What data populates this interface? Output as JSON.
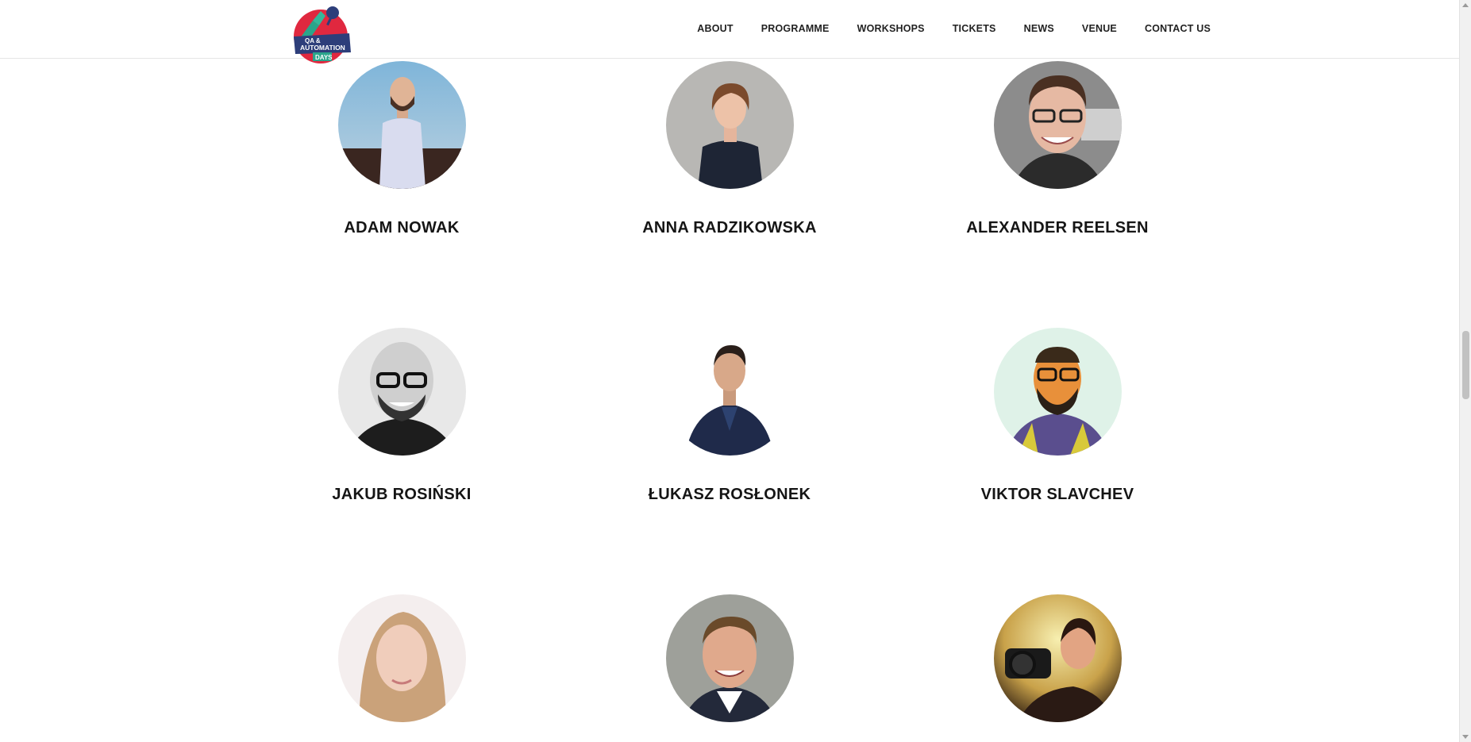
{
  "brand": {
    "logo_text_top": "QA &",
    "logo_text_mid": "AUTOMATION",
    "logo_text_bottom": "DAYS"
  },
  "nav": {
    "items": [
      {
        "label": "ABOUT"
      },
      {
        "label": "PROGRAMME"
      },
      {
        "label": "WORKSHOPS"
      },
      {
        "label": "TICKETS"
      },
      {
        "label": "NEWS"
      },
      {
        "label": "VENUE"
      },
      {
        "label": "CONTACT US"
      }
    ]
  },
  "speakers": [
    {
      "name": "ADAM NOWAK"
    },
    {
      "name": "ANNA RADZIKOWSKA"
    },
    {
      "name": "ALEXANDER REELSEN"
    },
    {
      "name": "JAKUB ROSIŃSKI"
    },
    {
      "name": "ŁUKASZ ROSŁONEK"
    },
    {
      "name": "VIKTOR SLAVCHEV"
    },
    {
      "name": ""
    },
    {
      "name": ""
    },
    {
      "name": ""
    }
  ],
  "colors": {
    "logo_red": "#e0283f",
    "logo_green": "#2aa58b",
    "logo_navy": "#2d3e7a",
    "text": "#151515"
  }
}
